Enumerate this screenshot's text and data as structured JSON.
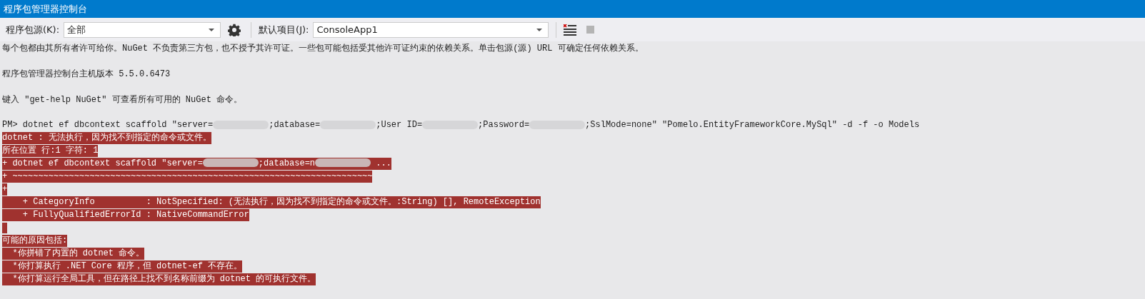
{
  "window": {
    "title": "程序包管理器控制台"
  },
  "toolbar": {
    "source_label": "程序包源(K):",
    "source_value": "全部",
    "project_label": "默认项目(J):",
    "project_value": "ConsoleApp1"
  },
  "console": {
    "lines": [
      {
        "kind": "plain",
        "segments": [
          {
            "kind": "text",
            "text": "每个包都由其所有者许可给你。NuGet 不负责第三方包，也不授予其许可证。一些包可能包括受其他许可证约束的依赖关系。单击包源(源) URL 可确定任何依赖关系。"
          }
        ]
      },
      {
        "kind": "gap"
      },
      {
        "kind": "plain",
        "segments": [
          {
            "kind": "text",
            "text": "程序包管理器控制台主机版本 5.5.0.6473"
          }
        ]
      },
      {
        "kind": "gap"
      },
      {
        "kind": "plain",
        "segments": [
          {
            "kind": "text",
            "text": "键入 \"get-help NuGet\" 可查看所有可用的 NuGet 命令。"
          }
        ]
      },
      {
        "kind": "gap"
      },
      {
        "kind": "plain",
        "segments": [
          {
            "kind": "text",
            "text": "PM> dotnet ef dbcontext scaffold \"server="
          },
          {
            "kind": "blur"
          },
          {
            "kind": "text",
            "text": ";database="
          },
          {
            "kind": "blur"
          },
          {
            "kind": "text",
            "text": ";User ID="
          },
          {
            "kind": "blur"
          },
          {
            "kind": "text",
            "text": ";Password="
          },
          {
            "kind": "blur"
          },
          {
            "kind": "text",
            "text": ";SslMode=none\" \"Pomelo.EntityFrameworkCore.MySql\" -d -f -o Models"
          }
        ]
      },
      {
        "kind": "error",
        "segments": [
          {
            "kind": "text",
            "text": "dotnet : 无法执行，因为找不到指定的命令或文件。"
          }
        ]
      },
      {
        "kind": "error",
        "segments": [
          {
            "kind": "text",
            "text": "所在位置 行:1 字符: 1"
          }
        ]
      },
      {
        "kind": "error",
        "segments": [
          {
            "kind": "text",
            "text": "+ dotnet ef dbcontext scaffold \"server="
          },
          {
            "kind": "blur"
          },
          {
            "kind": "text",
            "text": ";database=n"
          },
          {
            "kind": "blur"
          },
          {
            "kind": "text",
            "text": " ..."
          }
        ]
      },
      {
        "kind": "error",
        "segments": [
          {
            "kind": "text",
            "text": "+ ~~~~~~~~~~~~~~~~~~~~~~~~~~~~~~~~~~~~~~~~~~~~~~~~~~~~~~~~~~~~~~~~~~~~~~"
          }
        ]
      },
      {
        "kind": "error",
        "segments": [
          {
            "kind": "text",
            "text": "+"
          }
        ]
      },
      {
        "kind": "error",
        "segments": [
          {
            "kind": "text",
            "text": "    + CategoryInfo          : NotSpecified: (无法执行，因为找不到指定的命令或文件。:String) [], RemoteException"
          }
        ]
      },
      {
        "kind": "error",
        "segments": [
          {
            "kind": "text",
            "text": "    + FullyQualifiedErrorId : NativeCommandError"
          }
        ]
      },
      {
        "kind": "error-blank"
      },
      {
        "kind": "error",
        "segments": [
          {
            "kind": "text",
            "text": "可能的原因包括:"
          }
        ]
      },
      {
        "kind": "error",
        "segments": [
          {
            "kind": "text",
            "text": "  *你拼错了内置的 dotnet 命令。"
          }
        ]
      },
      {
        "kind": "error",
        "segments": [
          {
            "kind": "text",
            "text": "  *你打算执行 .NET Core 程序，但 dotnet-ef 不存在。"
          }
        ]
      },
      {
        "kind": "error",
        "segments": [
          {
            "kind": "text",
            "text": "  *你打算运行全局工具，但在路径上找不到名称前缀为 dotnet 的可执行文件。"
          }
        ]
      }
    ]
  }
}
